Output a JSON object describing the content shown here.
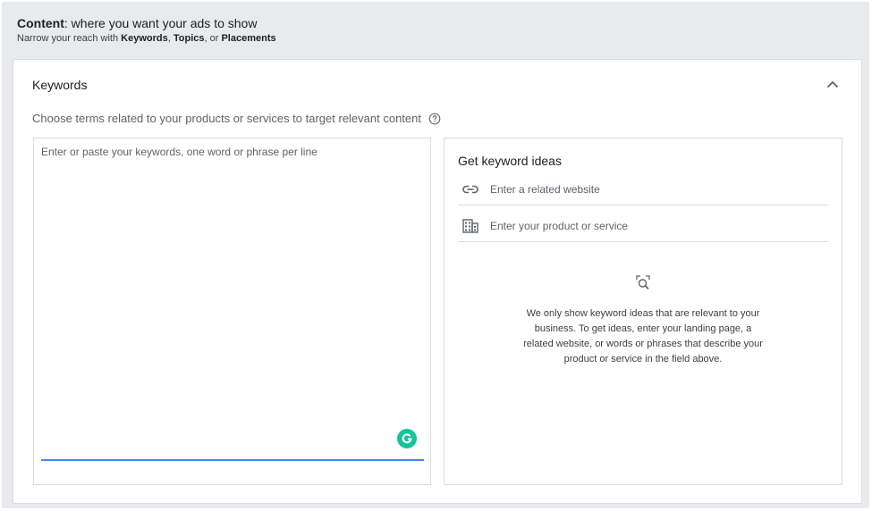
{
  "header": {
    "title_bold": "Content",
    "title_rest": ": where you want your ads to show",
    "sub_prefix": "Narrow your reach with ",
    "sub_keywords": "Keywords",
    "sub_sep1": ", ",
    "sub_topics": "Topics",
    "sub_sep2": ", or ",
    "sub_placements": "Placements"
  },
  "keywords": {
    "title": "Keywords",
    "description": "Choose terms related to your products or services to target relevant content",
    "textarea_placeholder": "Enter or paste your keywords, one word or phrase per line",
    "textarea_value": ""
  },
  "ideas": {
    "title": "Get keyword ideas",
    "website_placeholder": "Enter a related website",
    "product_placeholder": "Enter your product or service",
    "empty_message": "We only show keyword ideas that are relevant to your business. To get ideas, enter your landing page, a related website, or words or phrases that describe your product or service in the field above."
  },
  "icons": {
    "collapse": "chevron-up-icon",
    "help": "help-circle-icon",
    "link": "link-icon",
    "product": "building-icon",
    "empty": "search-document-icon",
    "grammarly": "grammarly-icon"
  },
  "colors": {
    "accent": "#4285f4",
    "grammarly": "#15c39a",
    "panel_bg": "#e8eaed"
  }
}
